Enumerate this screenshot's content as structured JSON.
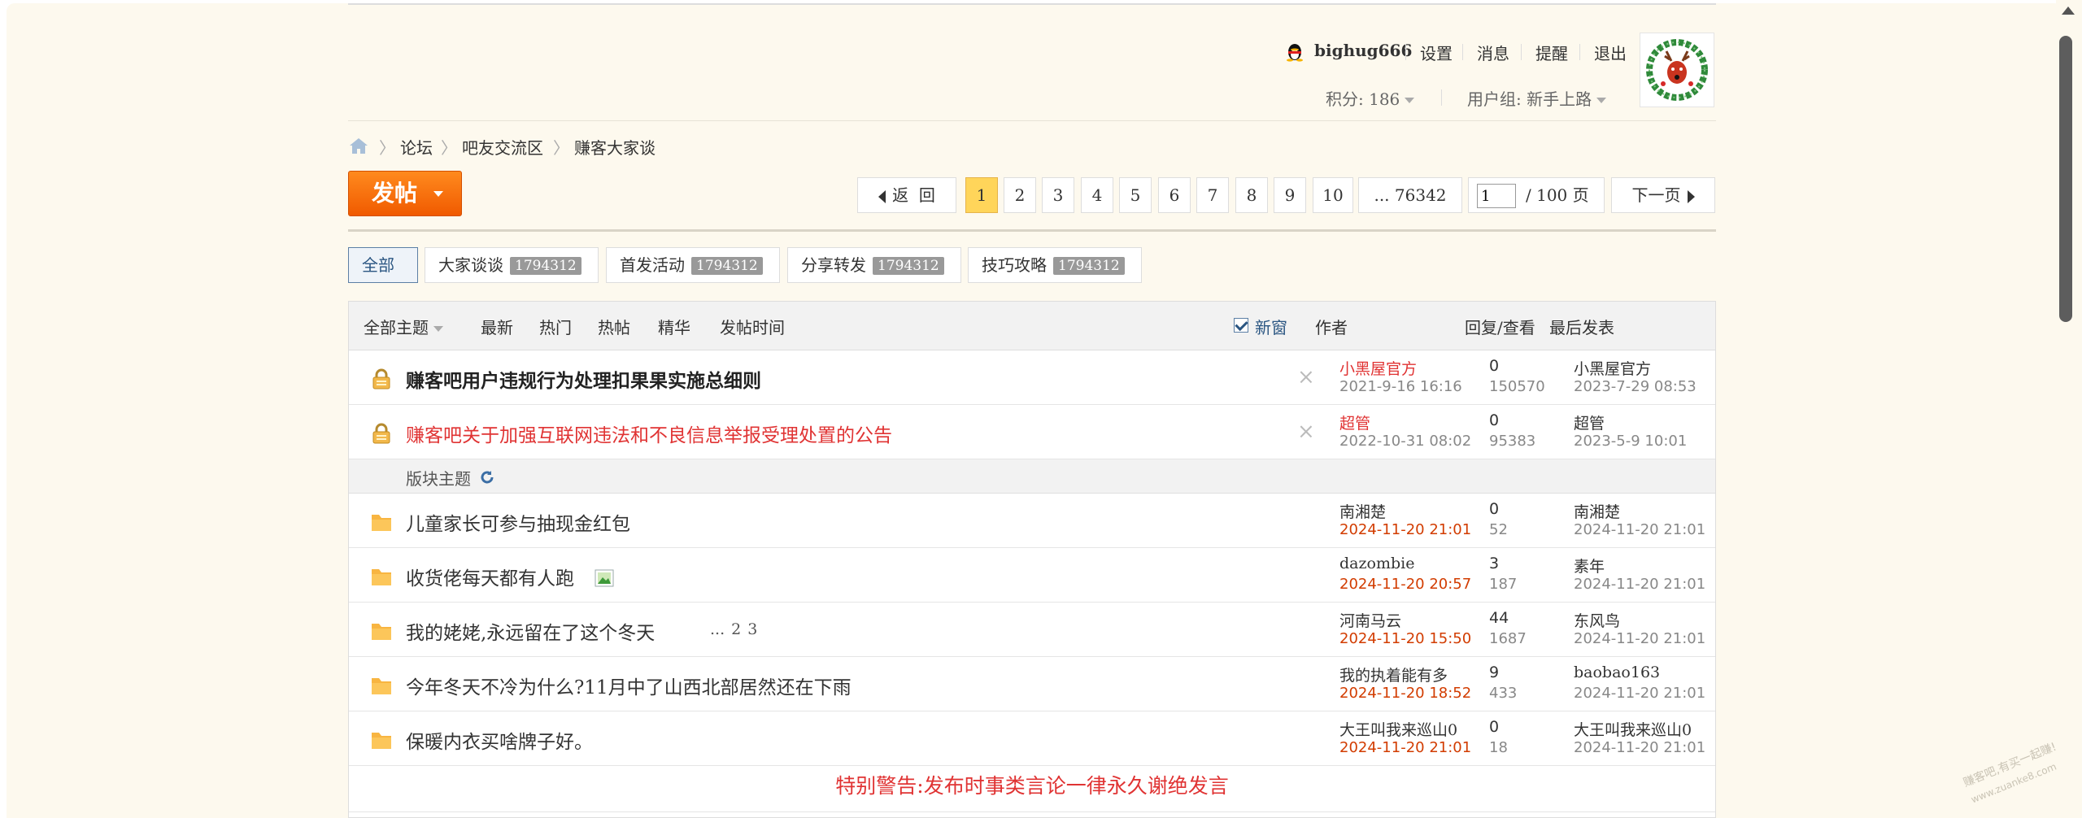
{
  "header": {
    "username": "bighug666",
    "links": [
      "设置",
      "消息",
      "提醒",
      "退出"
    ],
    "points": "积分: 186",
    "usergroup": "用户组: 新手上路"
  },
  "breadcrumb": [
    "论坛",
    "吧友交流区",
    "赚客大家谈"
  ],
  "post_button": "发帖",
  "pager": {
    "back": "返  回",
    "pages": [
      "1",
      "2",
      "3",
      "4",
      "5",
      "6",
      "7",
      "8",
      "9",
      "10"
    ],
    "current": "1",
    "last": "... 76342",
    "input_value": "1",
    "total": "/ 100 页",
    "next": "下一页"
  },
  "categories": [
    {
      "label": "全部",
      "count": ""
    },
    {
      "label": "大家谈谈",
      "count": "1794312"
    },
    {
      "label": "首发活动",
      "count": "1794312"
    },
    {
      "label": "分享转发",
      "count": "1794312"
    },
    {
      "label": "技巧攻略",
      "count": "1794312"
    }
  ],
  "table_header": {
    "all_topics": "全部主题",
    "filters": [
      "最新",
      "热门",
      "热帖",
      "精华",
      "发帖时间"
    ],
    "new_window": "新窗",
    "author": "作者",
    "reply_view": "回复/查看",
    "last_post": "最后发表"
  },
  "sticky_threads": [
    {
      "title": "赚客吧用户违规行为处理扣果果实施总细则",
      "author": "小黑屋官方",
      "date": "2021-9-16 16:16",
      "replies": "0",
      "views": "150570",
      "last_user": "小黑屋官方",
      "last_date": "2023-7-29 08:53"
    },
    {
      "title": "赚客吧关于加强互联网违法和不良信息举报受理处置的公告",
      "author": "超管",
      "date": "2022-10-31 08:02",
      "replies": "0",
      "views": "95383",
      "last_user": "超管",
      "last_date": "2023-5-9 10:01"
    }
  ],
  "section_label": "版块主题",
  "threads": [
    {
      "title": "儿童家长可参与抽现金红包",
      "author": "南湘楚",
      "date": "2024-11-20 21:01",
      "replies": "0",
      "views": "52",
      "last_user": "南湘楚",
      "last_date": "2024-11-20 21:01"
    },
    {
      "title": "收货佬每天都有人跑",
      "author": "dazombie",
      "date": "2024-11-20 20:57",
      "replies": "3",
      "views": "187",
      "last_user": "素年",
      "last_date": "2024-11-20 21:01"
    },
    {
      "title": "我的姥姥,永远留在了这个冬天",
      "author": "河南马云",
      "date": "2024-11-20 15:50",
      "replies": "44",
      "views": "1687",
      "last_user": "东风鸟",
      "last_date": "2024-11-20 21:01",
      "pages": [
        "...",
        "2",
        "3"
      ]
    },
    {
      "title": "今年冬天不冷为什么?11月中了山西北部居然还在下雨",
      "author": "我的执着能有多",
      "date": "2024-11-20 18:52",
      "replies": "9",
      "views": "433",
      "last_user": "baobao163",
      "last_date": "2024-11-20 21:01"
    },
    {
      "title": "保暖内衣买啥牌子好。",
      "author": "大王叫我来巡山0",
      "date": "2024-11-20 21:01",
      "replies": "0",
      "views": "18",
      "last_user": "大王叫我来巡山0",
      "last_date": "2024-11-20 21:01"
    }
  ],
  "warning": "特别警告:发布时事类言论一律永久谢绝发言",
  "watermark": [
    "赚客吧,有买一起赚!",
    "www.zuanke8.com"
  ],
  "colors": {
    "accent_orange": "#f05a00",
    "red_text": "#e03333",
    "new_date": "#d23c00",
    "current_page": "#ffd55a"
  }
}
